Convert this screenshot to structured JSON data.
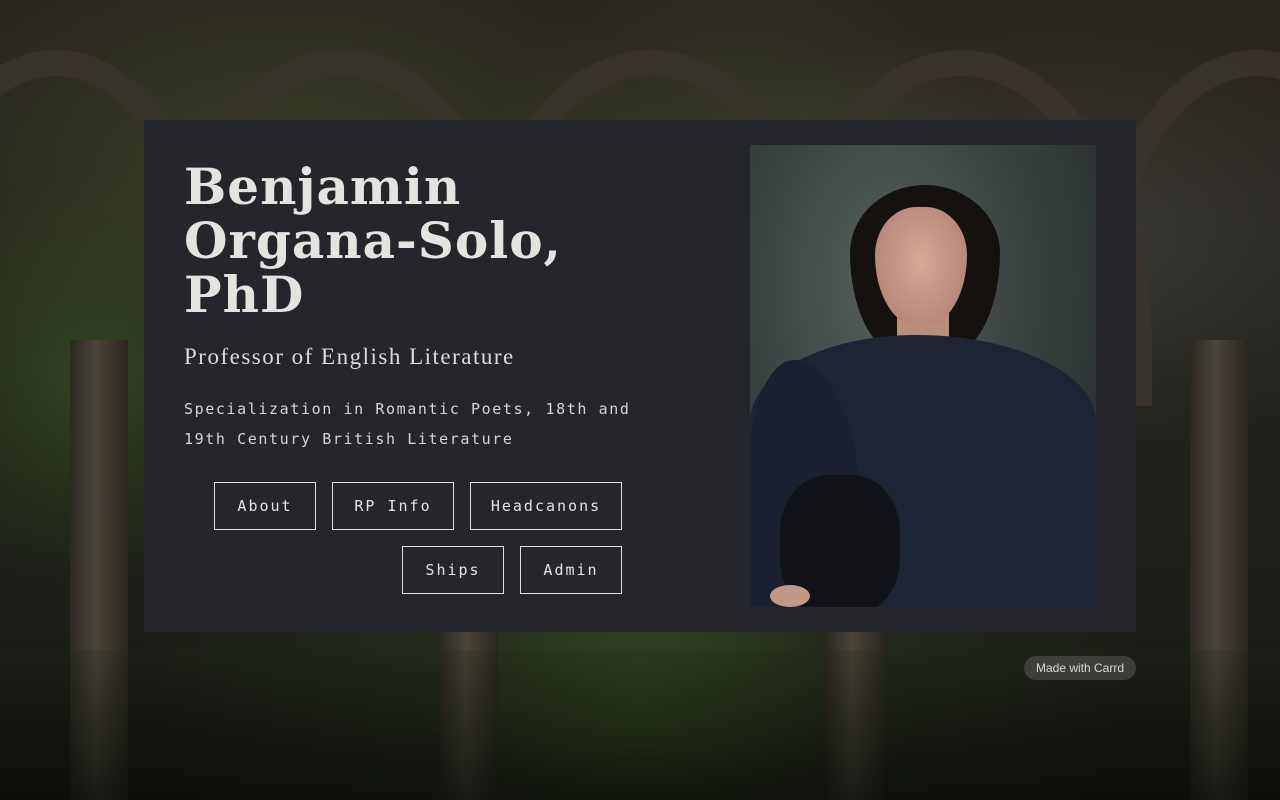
{
  "profile": {
    "name": "Benjamin Organa-Solo, PhD",
    "title": "Professor of English Literature",
    "specialization": "Specialization in Romantic Poets, 18th and 19th Century British Literature"
  },
  "nav": {
    "buttons": [
      "About",
      "RP Info",
      "Headcanons",
      "Ships",
      "Admin"
    ]
  },
  "footer": {
    "badge": "Made with Carrd"
  },
  "colors": {
    "card_background": "#25262b",
    "text": "#e4e3e0",
    "button_border": "#e0dfdc"
  }
}
